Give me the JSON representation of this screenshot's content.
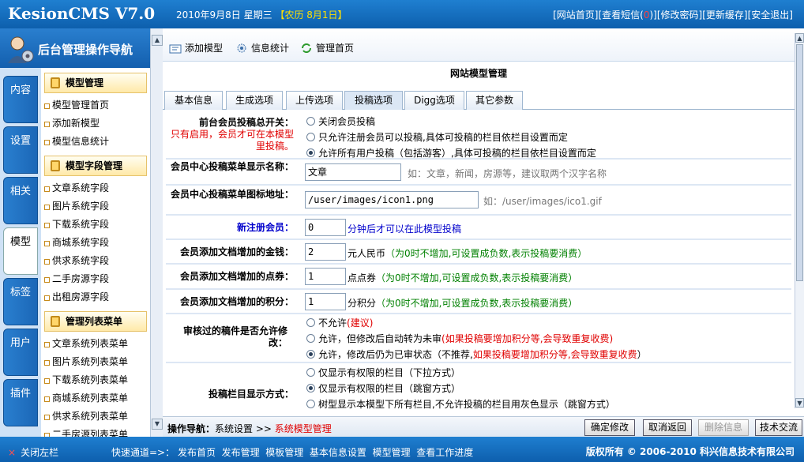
{
  "header": {
    "logo": "KesionCMS V7.0",
    "date": "2010年9月8日 星期三",
    "lunar": "【农历 8月1日】",
    "links": [
      "[网站首页]",
      "[查看短信(",
      "0",
      ")]",
      "[修改密码]",
      "[更新缓存]",
      "[安全退出]"
    ]
  },
  "sidebar": {
    "title": "后台管理操作导航",
    "tabs": [
      "内容",
      "设置",
      "相关",
      "模型",
      "标签",
      "用户",
      "插件"
    ],
    "active_tab": "模型",
    "sections": [
      {
        "title": "模型管理",
        "items": [
          "模型管理首页",
          "添加新模型",
          "模型信息统计"
        ]
      },
      {
        "title": "模型字段管理",
        "items": [
          "文章系统字段",
          "图片系统字段",
          "下载系统字段",
          "商城系统字段",
          "供求系统字段",
          "二手房源字段",
          "出租房源字段"
        ]
      },
      {
        "title": "管理列表菜单",
        "items": [
          "文章系统列表菜单",
          "图片系统列表菜单",
          "下载系统列表菜单",
          "商城系统列表菜单",
          "供求系统列表菜单",
          "二手房源列表菜单"
        ]
      }
    ]
  },
  "toolbar": {
    "add": "添加模型",
    "stats": "信息统计",
    "home": "管理首页"
  },
  "page": {
    "title": "网站模型管理",
    "tabs": [
      "基本信息",
      "生成选项",
      "上传选项",
      "投稿选项",
      "Digg选项",
      "其它参数"
    ],
    "active_tab": "投稿选项"
  },
  "form": {
    "switch": {
      "label": "前台会员投稿总开关：",
      "note": "只有启用，会员才可在本模型里投稿。",
      "options": [
        "关闭会员投稿",
        "只允许注册会员可以投稿,具体可投稿的栏目依栏目设置而定",
        "允许所有用户投稿（包括游客）,具体可投稿的栏目依栏目设置而定"
      ],
      "selected": 2
    },
    "menu_name": {
      "label": "会员中心投稿菜单显示名称：",
      "value": "文章",
      "hint": "如：文章，新闻，房源等，建议取两个汉字名称"
    },
    "menu_icon": {
      "label": "会员中心投稿菜单图标地址：",
      "value": "/user/images/icon1.png",
      "hint": "如：/user/images/ico1.gif"
    },
    "new_member": {
      "label": "新注册会员：",
      "value": "0",
      "suffix": "分钟后才可以在此模型投稿"
    },
    "money": {
      "label": "会员添加文档增加的金钱：",
      "value": "2",
      "suffix": "元人民币",
      "note": "（为0时不增加,可设置成负数,表示投稿要消费）"
    },
    "points": {
      "label": "会员添加文档增加的点券：",
      "value": "1",
      "suffix": "点点券",
      "note": "（为0时不增加,可设置成负数,表示投稿要消费）"
    },
    "score": {
      "label": "会员添加文档增加的积分：",
      "value": "1",
      "suffix": "分积分",
      "note": "（为0时不增加,可设置成负数,表示投稿要消费）"
    },
    "edit_review": {
      "label": "审核过的稿件是否允许修改：",
      "opt1": "不允许",
      "opt1_note": "(建议)",
      "opt2": "允许，但修改后自动转为未审",
      "opt2_note": "(如果投稿要增加积分等,会导致重复收费)",
      "opt3": "允许，修改后仍为已审状态（不推荐,",
      "opt3_note": "如果投稿要增加积分等,会导致重复收费",
      "opt3_end": "）",
      "selected": 2
    },
    "column_display": {
      "label": "投稿栏目显示方式：",
      "options": [
        "仅显示有权限的栏目（下拉方式）",
        "仅显示有权限的栏目（跳窗方式）",
        "树型显示本模型下所有栏目,不允许投稿的栏目用灰色显示（跳窗方式）"
      ],
      "selected": 1
    }
  },
  "bottom": {
    "crumb_label": "操作导航：",
    "crumb_1": "系统设置",
    "crumb_sep": ">>",
    "crumb_2": "系统模型管理",
    "buttons": [
      "确定修改",
      "取消返回",
      "删除信息",
      "技术交流"
    ]
  },
  "footer": {
    "close_left": "关闭左栏",
    "quick_label": "快速通道=>：",
    "quick_links": [
      "发布首页",
      "发布管理",
      "模板管理",
      "基本信息设置",
      "模型管理",
      "查看工作进度"
    ],
    "copyright": "版权所有 © 2006-2010 科兴信息技术有限公司"
  }
}
